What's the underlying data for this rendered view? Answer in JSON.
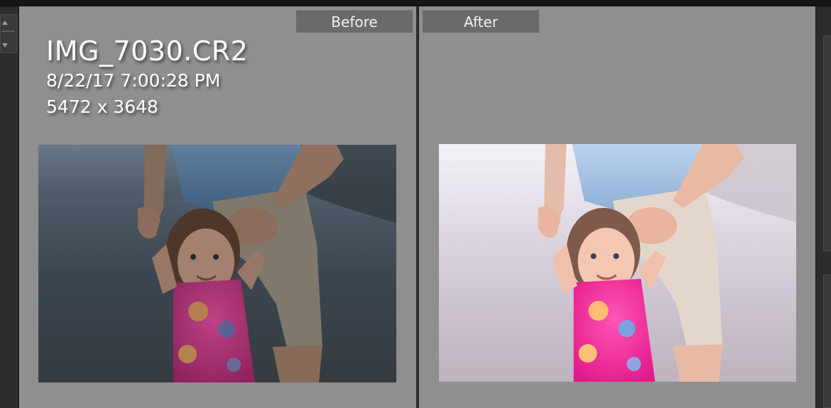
{
  "compare": {
    "before_label": "Before",
    "after_label": "After"
  },
  "image_info": {
    "filename": "IMG_7030.CR2",
    "datetime": "8/22/17 7:00:28 PM",
    "dimensions": "5472 x 3648"
  },
  "colors": {
    "panel_bg": "#8f8f8f",
    "tab_bg": "#6a6a6a",
    "app_dark": "#2c2c2c",
    "text": "#ffffff"
  },
  "icons": {
    "left_scroll": "up-down-arrows-icon"
  }
}
